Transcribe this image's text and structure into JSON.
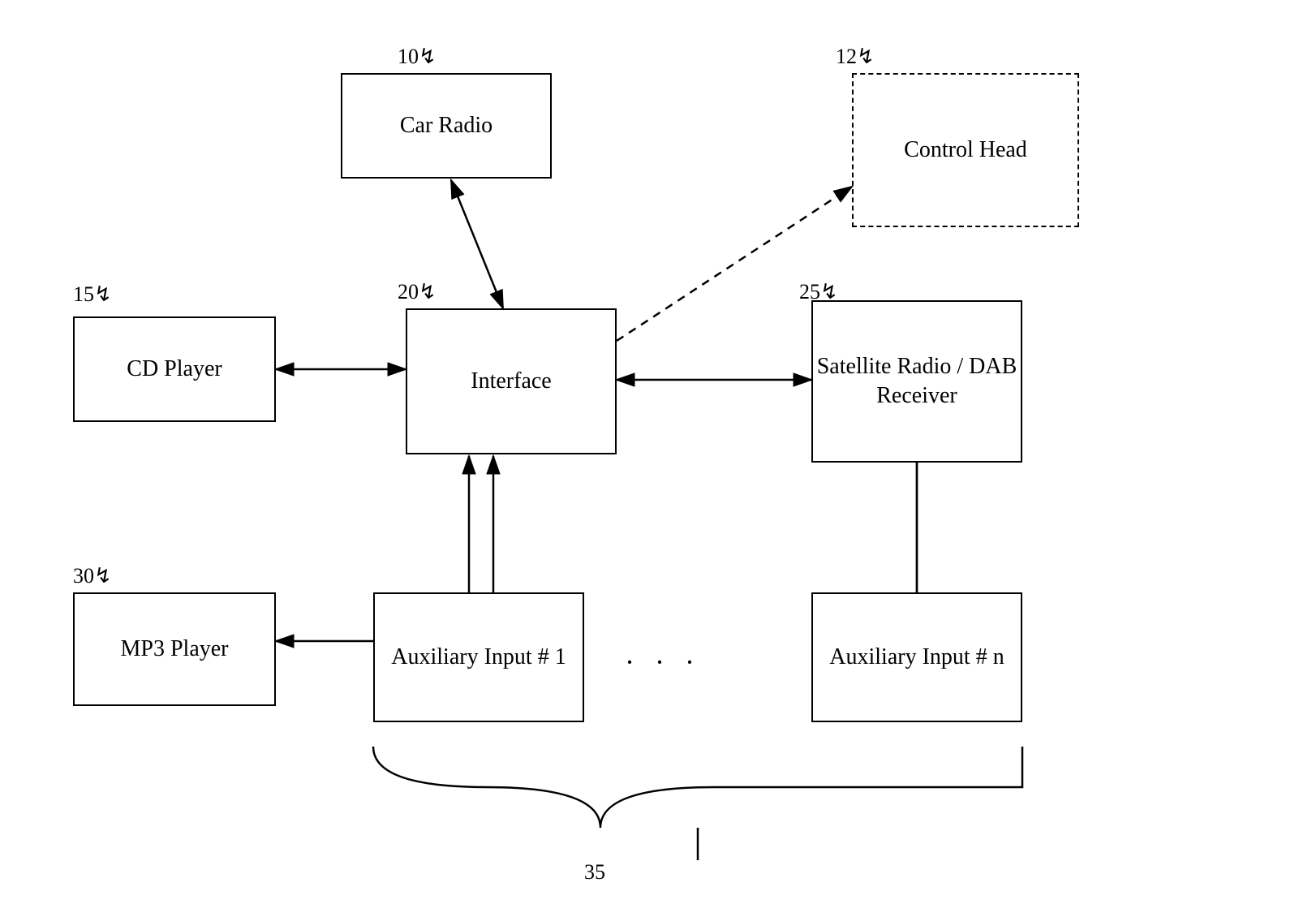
{
  "boxes": {
    "car_radio": {
      "label": "Car Radio"
    },
    "control_head": {
      "label": "Control\nHead"
    },
    "cd_player": {
      "label": "CD Player"
    },
    "interface": {
      "label": "Interface"
    },
    "satellite_radio": {
      "label": "Satellite\nRadio / DAB\nReceiver"
    },
    "mp3_player": {
      "label": "MP3\nPlayer"
    },
    "aux_input_1": {
      "label": "Auxiliary\nInput # 1"
    },
    "aux_input_n": {
      "label": "Auxiliary\nInput # n"
    }
  },
  "refs": {
    "r10": "10",
    "r12": "12",
    "r15": "15",
    "r20": "20",
    "r25": "25",
    "r30": "30",
    "r35": "35"
  }
}
